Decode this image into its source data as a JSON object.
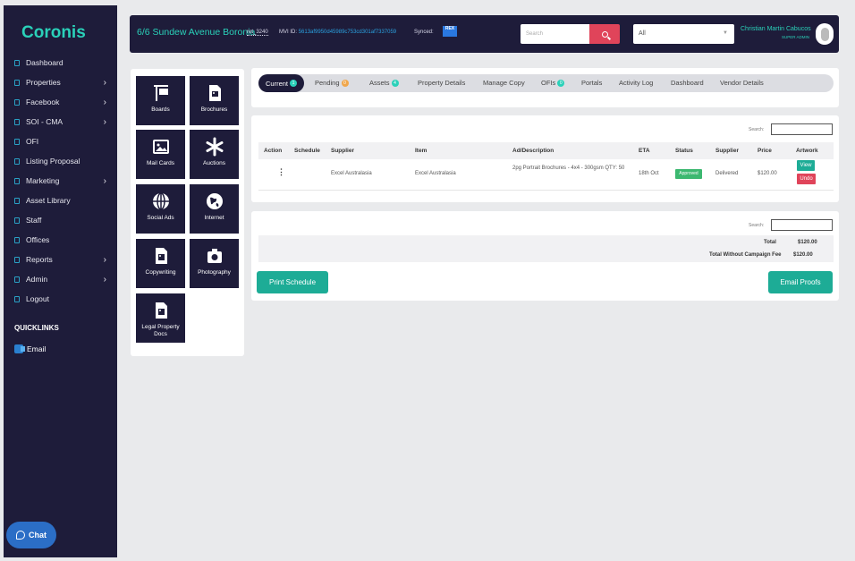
{
  "app": {
    "name": "Coronis"
  },
  "sidebar": {
    "items": [
      {
        "label": "Dashboard",
        "arrow": ""
      },
      {
        "label": "Properties",
        "arrow": "›"
      },
      {
        "label": "Facebook",
        "arrow": "›"
      },
      {
        "label": "SOI - CMA",
        "arrow": "›"
      },
      {
        "label": "OFI",
        "arrow": ""
      },
      {
        "label": "Listing Proposal",
        "arrow": ""
      },
      {
        "label": "Marketing",
        "arrow": "›"
      },
      {
        "label": "Asset Library",
        "arrow": ""
      },
      {
        "label": "Staff",
        "arrow": ""
      },
      {
        "label": "Offices",
        "arrow": ""
      },
      {
        "label": "Reports",
        "arrow": "›"
      },
      {
        "label": "Admin",
        "arrow": "›"
      },
      {
        "label": "Logout",
        "arrow": ""
      }
    ],
    "quicklinks_title": "QUICKLINKS",
    "quicklinks": [
      {
        "label": "Email"
      }
    ],
    "chat_label": "Chat"
  },
  "header": {
    "address": "6/6 Sundew Avenue Boronia",
    "ret": "ret_3240",
    "mvi_label": "MVI ID:",
    "mvi_value": "5613af9950d45989c753cd301af7337059",
    "synced_label": "Synced:",
    "rex_label": "REX",
    "search_placeholder": "Search",
    "select_value": "All",
    "user_name": "Christian Martin Cabucos",
    "user_role": "SUPER ADMIN"
  },
  "tiles": [
    {
      "label": "Boards",
      "icon": "sign-board-icon"
    },
    {
      "label": "Brochures",
      "icon": "brochure-icon"
    },
    {
      "label": "Mail Cards",
      "icon": "image-icon"
    },
    {
      "label": "Auctions",
      "icon": "asterisk-icon"
    },
    {
      "label": "Social Ads",
      "icon": "globe-icon"
    },
    {
      "label": "Internet",
      "icon": "earth-icon"
    },
    {
      "label": "Copywriting",
      "icon": "document-image-icon"
    },
    {
      "label": "Photography",
      "icon": "camera-icon"
    },
    {
      "label": "Legal Property Docs",
      "icon": "legal-doc-icon"
    }
  ],
  "tabs": [
    {
      "label": "Current",
      "badge": "1",
      "badge_color": "teal",
      "active": true
    },
    {
      "label": "Pending",
      "badge": "0",
      "badge_color": "orange"
    },
    {
      "label": "Assets",
      "badge": "4",
      "badge_color": "teal"
    },
    {
      "label": "Property Details"
    },
    {
      "label": "Manage Copy"
    },
    {
      "label": "OFIs",
      "badge": "0",
      "badge_color": "teal"
    },
    {
      "label": "Portals"
    },
    {
      "label": "Activity Log"
    },
    {
      "label": "Dashboard"
    },
    {
      "label": "Vendor Details"
    }
  ],
  "orders": {
    "search_label": "Search:",
    "columns": [
      "Action",
      "Schedule",
      "Supplier",
      "Item",
      "Ad/Description",
      "ETA",
      "Status",
      "Supplier",
      "Price",
      "Artwork"
    ],
    "rows": [
      {
        "action": "⋮",
        "schedule": "",
        "supplier": "Excel Australasia",
        "item": "Excel Australasia",
        "description": "2pg Portrait Brochures - 4x4 - 300gsm QTY: 50",
        "eta": "18th Oct",
        "status": "Approved",
        "supplier_status": "Delivered",
        "price": "$120.00",
        "view_label": "View",
        "undo_label": "Undo"
      }
    ]
  },
  "totals": {
    "search_label": "Search:",
    "total_label": "Total",
    "total_value": "$120.00",
    "without_fee_label": "Total Without Campaign Fee",
    "without_fee_value": "$120.00",
    "print_label": "Print Schedule",
    "email_label": "Email Proofs"
  },
  "colors": {
    "sidebar": "#1e1c3a",
    "accent": "#2ad1b9",
    "button": "#1dac96",
    "danger": "#e0445a",
    "approved": "#3cb870"
  }
}
